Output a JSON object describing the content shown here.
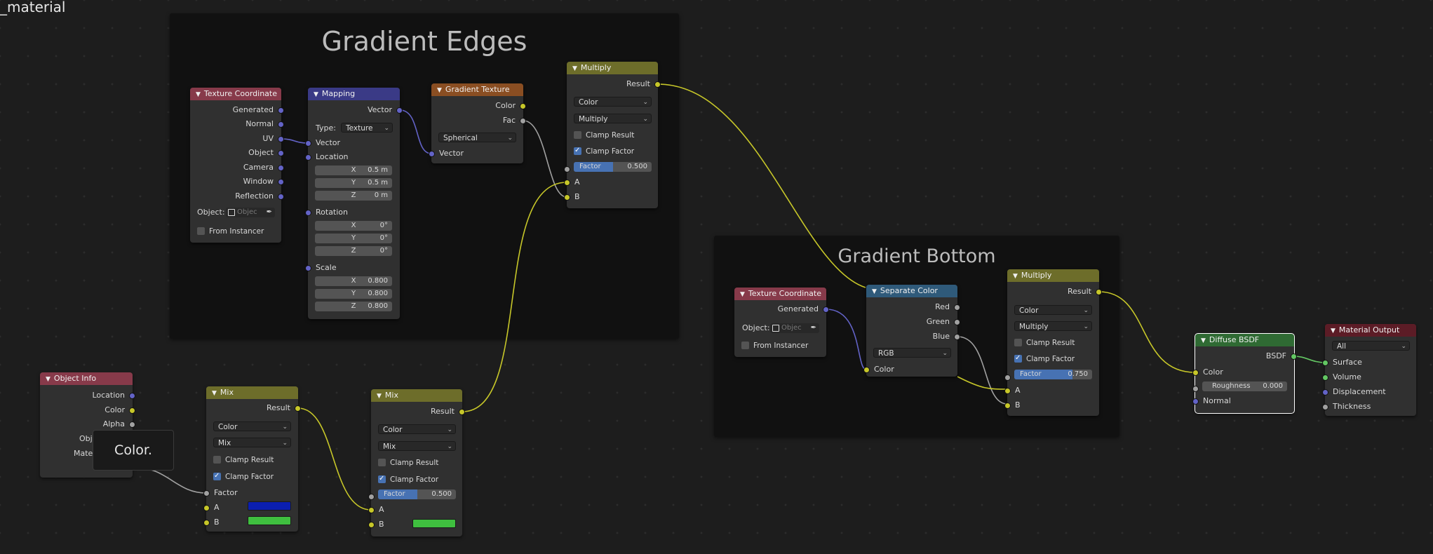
{
  "editor": {
    "title": "_material"
  },
  "frames": {
    "edges": {
      "label": "Gradient Edges"
    },
    "bottom": {
      "label": "Gradient Bottom"
    }
  },
  "colors": {
    "wire_yellow": "#c7c729",
    "wire_blue": "#6363c7",
    "wire_gray": "#a1a1a1",
    "mix_b_color": "#0b1fb0",
    "mix_green": "#3fbf3f"
  },
  "nodes": {
    "texcoord1": {
      "title": "Texture Coordinate",
      "outputs": [
        "Generated",
        "Normal",
        "UV",
        "Object",
        "Camera",
        "Window",
        "Reflection"
      ],
      "object_label": "Object:",
      "object_placeholder": "Objec",
      "from_instancer": "From Instancer"
    },
    "mapping": {
      "title": "Mapping",
      "out_vector": "Vector",
      "type_label": "Type:",
      "type_value": "Texture",
      "in_vector": "Vector",
      "location": "Location",
      "loc": [
        {
          "a": "X",
          "v": "0.5 m"
        },
        {
          "a": "Y",
          "v": "0.5 m"
        },
        {
          "a": "Z",
          "v": "0 m"
        }
      ],
      "rotation": "Rotation",
      "rot": [
        {
          "a": "X",
          "v": "0°"
        },
        {
          "a": "Y",
          "v": "0°"
        },
        {
          "a": "Z",
          "v": "0°"
        }
      ],
      "scale": "Scale",
      "scl": [
        {
          "a": "X",
          "v": "0.800"
        },
        {
          "a": "Y",
          "v": "0.800"
        },
        {
          "a": "Z",
          "v": "0.800"
        }
      ]
    },
    "gradient": {
      "title": "Gradient Texture",
      "out_color": "Color",
      "out_fac": "Fac",
      "type": "Spherical",
      "in_vector": "Vector"
    },
    "multiply1": {
      "title": "Multiply",
      "result": "Result",
      "mode1": "Color",
      "mode2": "Multiply",
      "clamp_result": "Clamp Result",
      "clamp_factor": "Clamp Factor",
      "factor_label": "Factor",
      "factor_value": "0.500",
      "factor": 0.5,
      "a": "A",
      "b": "B"
    },
    "objinfo": {
      "title": "Object Info",
      "outputs": [
        "Location",
        "Color",
        "Alpha"
      ],
      "partial1": "Obj",
      "partial2": "Mate"
    },
    "tooltip": {
      "text": "Color."
    },
    "mix1": {
      "title": "Mix",
      "result": "Result",
      "mode1": "Color",
      "mode2": "Mix",
      "clamp_result": "Clamp Result",
      "clamp_factor": "Clamp Factor",
      "factor": "Factor",
      "a": "A",
      "b": "B"
    },
    "mix2": {
      "title": "Mix",
      "result": "Result",
      "mode1": "Color",
      "mode2": "Mix",
      "clamp_result": "Clamp Result",
      "clamp_factor": "Clamp Factor",
      "factor_label": "Factor",
      "factor_value": "0.500",
      "factor": 0.5,
      "a": "A",
      "b": "B"
    },
    "texcoord2": {
      "title": "Texture Coordinate",
      "out": "Generated",
      "object_label": "Object:",
      "object_placeholder": "Objec",
      "from_instancer": "From Instancer"
    },
    "sepcolor": {
      "title": "Separate Color",
      "outputs": [
        "Red",
        "Green",
        "Blue"
      ],
      "mode": "RGB",
      "in_color": "Color"
    },
    "multiply2": {
      "title": "Multiply",
      "result": "Result",
      "mode1": "Color",
      "mode2": "Multiply",
      "clamp_result": "Clamp Result",
      "clamp_factor": "Clamp Factor",
      "factor_label": "Factor",
      "factor_value": "0.750",
      "factor": 0.75,
      "a": "A",
      "b": "B"
    },
    "diffuse": {
      "title": "Diffuse BSDF",
      "out": "BSDF",
      "in_color": "Color",
      "roughness_label": "Roughness",
      "roughness_value": "0.000",
      "in_normal": "Normal"
    },
    "output": {
      "title": "Material Output",
      "target": "All",
      "inputs": [
        "Surface",
        "Volume",
        "Displacement",
        "Thickness"
      ]
    }
  }
}
